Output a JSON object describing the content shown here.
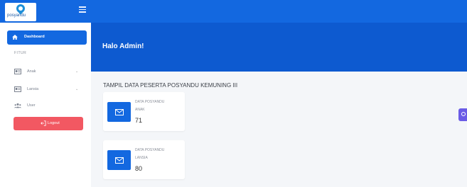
{
  "brand": {
    "logo_text": "posyandu"
  },
  "sidebar": {
    "active_item": {
      "label": "Dashboard"
    },
    "section_label": "FITUR",
    "items": [
      {
        "label": "Anak",
        "chevron": "⌄"
      },
      {
        "label": "Lansia",
        "chevron": "⌄"
      },
      {
        "label": "User"
      }
    ],
    "logout_label": "Logout"
  },
  "header": {
    "greeting": "Halo Admin!"
  },
  "main": {
    "title": "TAMPIL DATA PESERTA POSYANDU KEMUNING III",
    "cards": [
      {
        "title_line1": "DATA POSYANDU",
        "title_line2": "ANAK",
        "value": "71"
      },
      {
        "title_line1": "DATA POSYANDU",
        "title_line2": "LANSIA",
        "value": "80"
      }
    ]
  },
  "colors": {
    "primary": "#1368e0",
    "hero": "#0d5ad0",
    "logout": "#f25862",
    "widget": "#6a5be6",
    "background": "#f4f6f9"
  },
  "icons": {
    "dashboard": "home-icon",
    "anak": "id-card-icon",
    "lansia": "id-card-icon",
    "user": "users-icon",
    "logout": "logout-icon",
    "cards": "envelope-icon"
  }
}
